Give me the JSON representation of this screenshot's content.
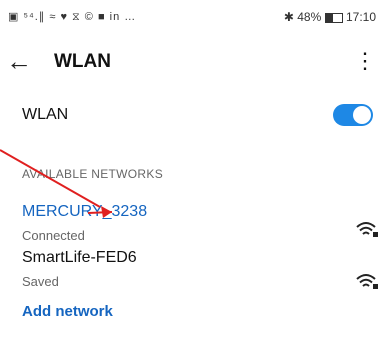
{
  "status_bar": {
    "left_icons": "▣ ⁵⁴.∥ ≈ ♥ ⧖ © ■ in …",
    "bluetooth": "✱",
    "battery": "48%",
    "time": "17:10"
  },
  "appbar": {
    "back": "←",
    "title": "WLAN",
    "more": "⋮"
  },
  "wlan_row": {
    "label": "WLAN",
    "toggle_on": true
  },
  "section": {
    "label": "AVAILABLE NETWORKS"
  },
  "networks": [
    {
      "name": "MERCURY_3238",
      "status": "Connected",
      "color": "#1565c0"
    },
    {
      "name": "SmartLife-FED6",
      "status": "Saved",
      "color": "#111111"
    }
  ],
  "add_network": "Add network",
  "colors": {
    "accent": "#1e88e5",
    "annotation": "#e02020"
  }
}
